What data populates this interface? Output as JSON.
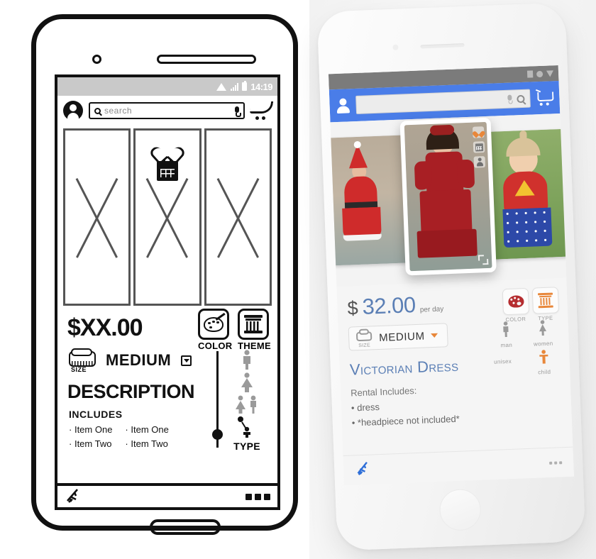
{
  "wireframe": {
    "status_bar": {
      "time": "14:19",
      "icons": [
        "wifi-icon",
        "signal-icon",
        "battery-icon"
      ]
    },
    "app_bar": {
      "avatar_icon": "account-avatar-icon",
      "search_placeholder": "search",
      "search_icon": "search-icon",
      "mic_icon": "microphone-icon",
      "cart_icon": "shopping-cart-icon"
    },
    "gallery": {
      "placeholder_count": 3,
      "favorite_icon": "heart-outline-icon",
      "calendar_icon": "calendar-icon"
    },
    "price": "$XX.00",
    "size": {
      "label": "SIZE",
      "value": "MEDIUM",
      "caret_icon": "dropdown-caret-icon"
    },
    "color": {
      "label": "COLOR",
      "icon": "palette-icon"
    },
    "theme": {
      "label": "THEME",
      "icon": "column-icon"
    },
    "description_heading": "DESCRIPTION",
    "includes_heading": "INCLUDES",
    "includes_col1": [
      "Item One",
      "Item Two"
    ],
    "includes_col2": [
      "Item One",
      "Item Two"
    ],
    "type": {
      "label": "TYPE",
      "options": [
        "man-icon",
        "woman-icon",
        "unisex-icon",
        "child-icon"
      ],
      "selected": "child-icon"
    },
    "footer": {
      "logo_icon": "brand-logo-icon",
      "overflow_icon": "more-options-icon"
    }
  },
  "mockup": {
    "status_bar": {
      "icons": [
        "sim-icon",
        "circle-icon",
        "download-icon"
      ]
    },
    "app_bar": {
      "avatar_icon": "account-avatar-icon",
      "search_value": "",
      "mic_icon": "microphone-icon",
      "search_icon": "search-icon",
      "cart_icon": "shopping-cart-icon"
    },
    "gallery": {
      "photos": [
        "santa-girl-costume",
        "victorian-red-dress",
        "wonder-woman-toddler"
      ],
      "featured_index": 1,
      "overlay_icons": [
        "favorite-heart-icon",
        "calendar-icon",
        "person-icon"
      ],
      "expand_icon": "expand-fullscreen-icon"
    },
    "price": {
      "currency": "$",
      "amount": "32.00",
      "unit": "per day"
    },
    "size": {
      "label": "SIZE",
      "value": "MEDIUM",
      "caret_icon": "dropdown-caret-icon"
    },
    "color": {
      "label": "COLOR",
      "icon": "palette-icon"
    },
    "type_swatch": {
      "label": "TYPE",
      "icon": "column-icon"
    },
    "title": "Victorian Dress",
    "includes_heading": "Rental Includes:",
    "includes": [
      "dress",
      "*headpiece not included*"
    ],
    "audience": {
      "options": [
        "man",
        "women",
        "unisex",
        "child"
      ],
      "selected": "child"
    },
    "footer": {
      "logo_icon": "brand-logo-icon",
      "overflow_icon": "more-options-icon"
    },
    "colors": {
      "app_bar": "#4a7de8",
      "status_bar": "#7b7b7b",
      "accent": "#e8873a",
      "title": "#5b7fb5",
      "palette_red": "#b52d30"
    }
  }
}
